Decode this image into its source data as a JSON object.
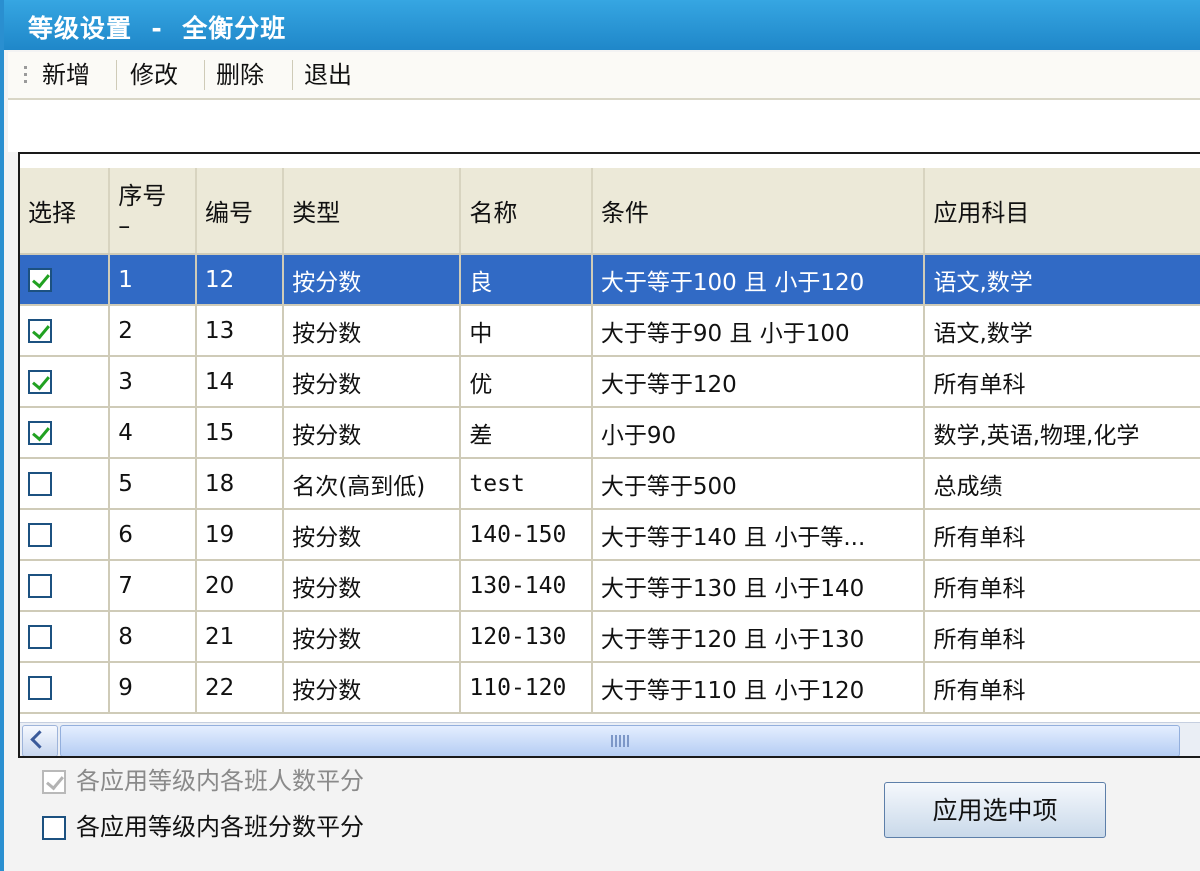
{
  "window": {
    "title": "等级设置  -  全衡分班"
  },
  "toolbar": {
    "buttons": [
      {
        "label": "新增"
      },
      {
        "label": "修改"
      },
      {
        "label": "删除"
      },
      {
        "label": "退出"
      }
    ]
  },
  "grid": {
    "columns": [
      "选择",
      "序号\n–",
      "编号",
      "类型",
      "名称",
      "条件",
      "应用科目"
    ],
    "rows": [
      {
        "checked": true,
        "selected": true,
        "seq": "1",
        "code": "12",
        "type": "按分数",
        "name": "良",
        "condition": "大于等于100 且 小于120",
        "subjects": "语文,数学"
      },
      {
        "checked": true,
        "selected": false,
        "seq": "2",
        "code": "13",
        "type": "按分数",
        "name": "中",
        "condition": "大于等于90 且 小于100",
        "subjects": "语文,数学"
      },
      {
        "checked": true,
        "selected": false,
        "seq": "3",
        "code": "14",
        "type": "按分数",
        "name": "优",
        "condition": "大于等于120",
        "subjects": "所有单科"
      },
      {
        "checked": true,
        "selected": false,
        "seq": "4",
        "code": "15",
        "type": "按分数",
        "name": "差",
        "condition": "小于90",
        "subjects": "数学,英语,物理,化学"
      },
      {
        "checked": false,
        "selected": false,
        "seq": "5",
        "code": "18",
        "type": "名次(高到低)",
        "name": "test",
        "condition": "大于等于500",
        "subjects": "总成绩"
      },
      {
        "checked": false,
        "selected": false,
        "seq": "6",
        "code": "19",
        "type": "按分数",
        "name": "140-150",
        "condition": "大于等于140 且 小于等...",
        "subjects": "所有单科"
      },
      {
        "checked": false,
        "selected": false,
        "seq": "7",
        "code": "20",
        "type": "按分数",
        "name": "130-140",
        "condition": "大于等于130 且 小于140",
        "subjects": "所有单科"
      },
      {
        "checked": false,
        "selected": false,
        "seq": "8",
        "code": "21",
        "type": "按分数",
        "name": "120-130",
        "condition": "大于等于120 且 小于130",
        "subjects": "所有单科"
      },
      {
        "checked": false,
        "selected": false,
        "seq": "9",
        "code": "22",
        "type": "按分数",
        "name": "110-120",
        "condition": "大于等于110 且 小于120",
        "subjects": "所有单科"
      }
    ]
  },
  "options": {
    "opt1": {
      "label": "各应用等级内各班人数平分",
      "checked": true,
      "disabled": true
    },
    "opt2": {
      "label": "各应用等级内各班分数平分",
      "checked": false,
      "disabled": false
    }
  },
  "apply_button": {
    "label": "应用选中项"
  },
  "colors": {
    "title_bar": "#2a8fd0",
    "selection": "#316ac5",
    "header_bg": "#ece9d8"
  }
}
